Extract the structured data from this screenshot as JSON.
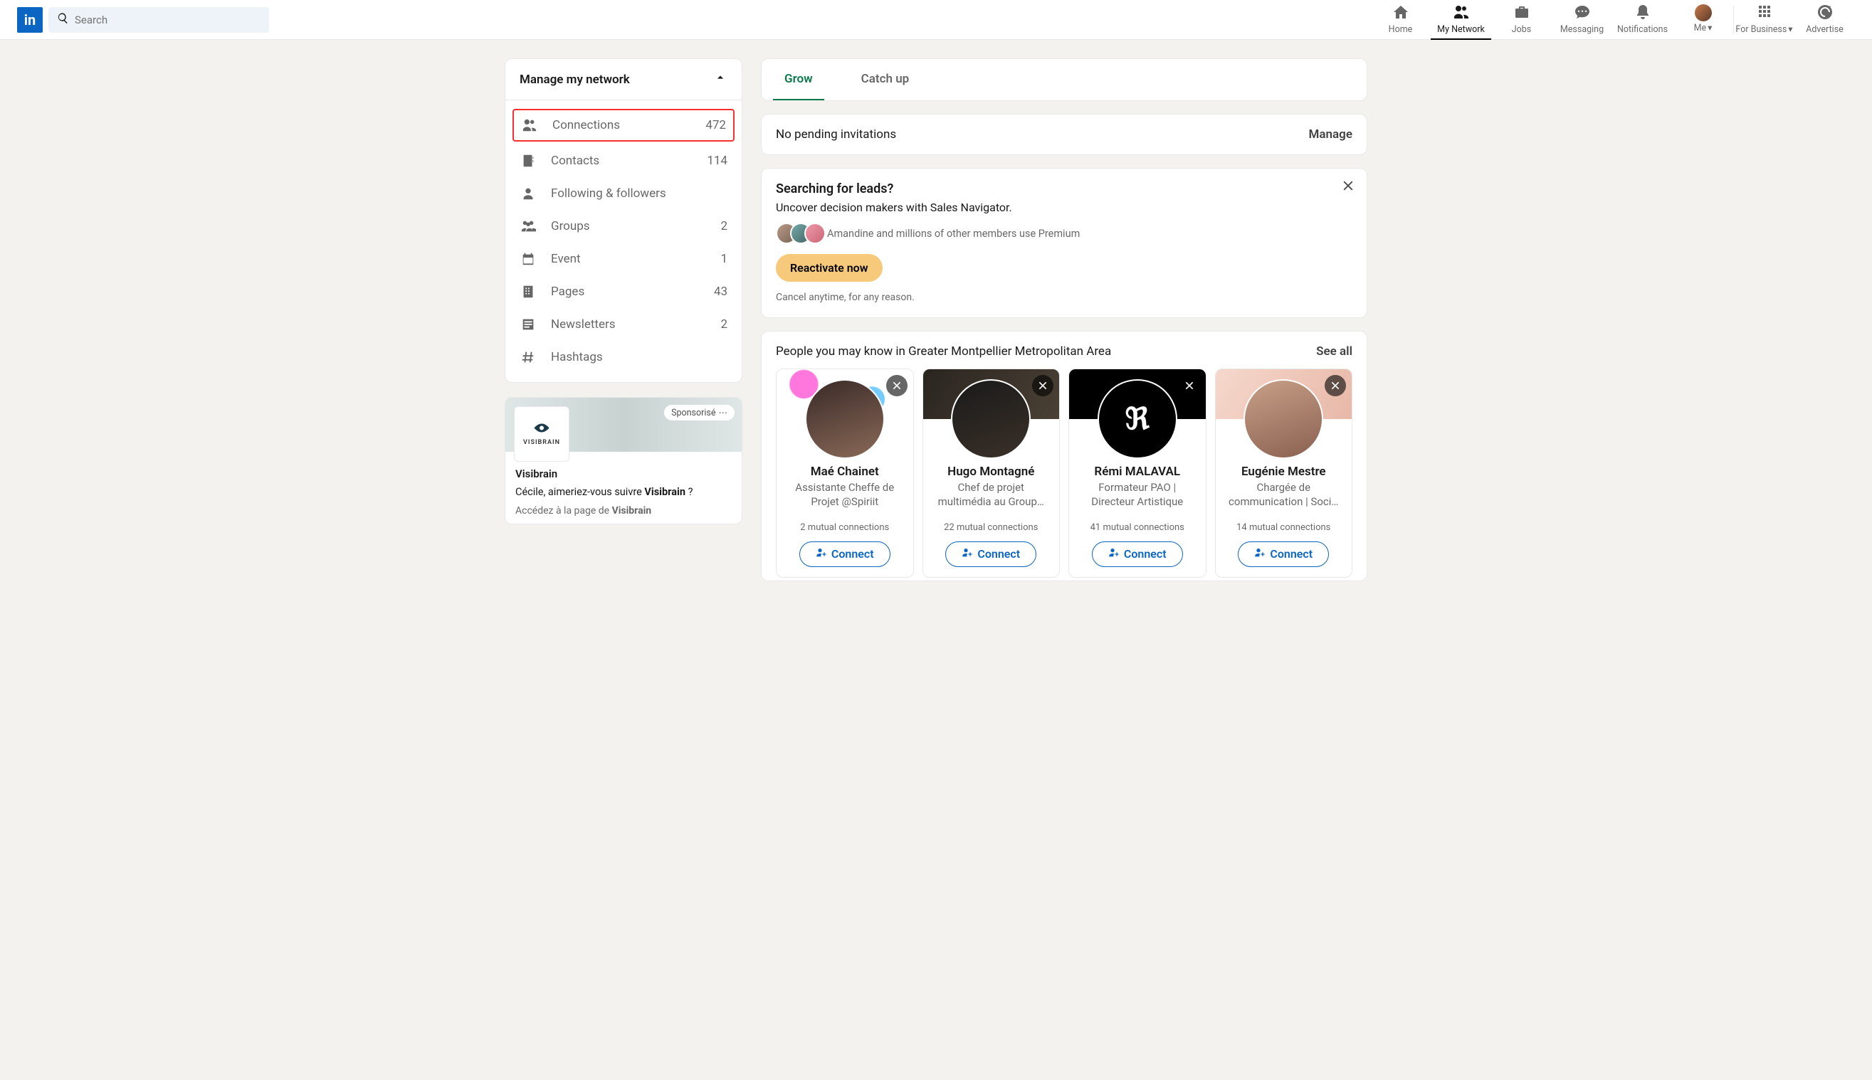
{
  "nav": {
    "search_placeholder": "Search",
    "home": "Home",
    "network": "My Network",
    "jobs": "Jobs",
    "messaging": "Messaging",
    "notifications": "Notifications",
    "me": "Me",
    "business": "For Business",
    "advertise": "Advertise"
  },
  "sidebar": {
    "title": "Manage my network",
    "items": [
      {
        "label": "Connections",
        "count": "472"
      },
      {
        "label": "Contacts",
        "count": "114"
      },
      {
        "label": "Following & followers",
        "count": ""
      },
      {
        "label": "Groups",
        "count": "2"
      },
      {
        "label": "Event",
        "count": "1"
      },
      {
        "label": "Pages",
        "count": "43"
      },
      {
        "label": "Newsletters",
        "count": "2"
      },
      {
        "label": "Hashtags",
        "count": ""
      }
    ]
  },
  "ad": {
    "badge": "Sponsorisé",
    "brand": "VISIBRAIN",
    "title": "Visibrain",
    "line_pre": "Cécile, aimeriez-vous suivre ",
    "line_bold": "Visibrain",
    "line_post": " ?",
    "sub_pre": "Accédez à la page de ",
    "sub_bold": "Visibrain"
  },
  "tabs": {
    "grow": "Grow",
    "catchup": "Catch up"
  },
  "invites": {
    "title": "No pending invitations",
    "manage": "Manage"
  },
  "leads": {
    "title": "Searching for leads?",
    "subtitle": "Uncover decision makers with Sales Navigator.",
    "facepile_text": "Amandine and millions of other members use Premium",
    "cta": "Reactivate now",
    "cancel": "Cancel anytime, for any reason."
  },
  "pymk": {
    "title": "People you may know in Greater Montpellier Metropolitan Area",
    "see_all": "See all",
    "connect_label": "Connect",
    "people": [
      {
        "name": "Maé Chainet",
        "role": "Assistante Cheffe de Projet @Spiriit",
        "mutual": "2 mutual connections"
      },
      {
        "name": "Hugo Montagné",
        "role": "Chef de projet multimédia au Group…",
        "mutual": "22 mutual connections"
      },
      {
        "name": "Rémi MALAVAL",
        "role": "Formateur PAO | Directeur Artistique",
        "mutual": "41 mutual connections"
      },
      {
        "name": "Eugénie Mestre",
        "role": "Chargée de communication | Soci…",
        "mutual": "14 mutual connections"
      }
    ]
  }
}
